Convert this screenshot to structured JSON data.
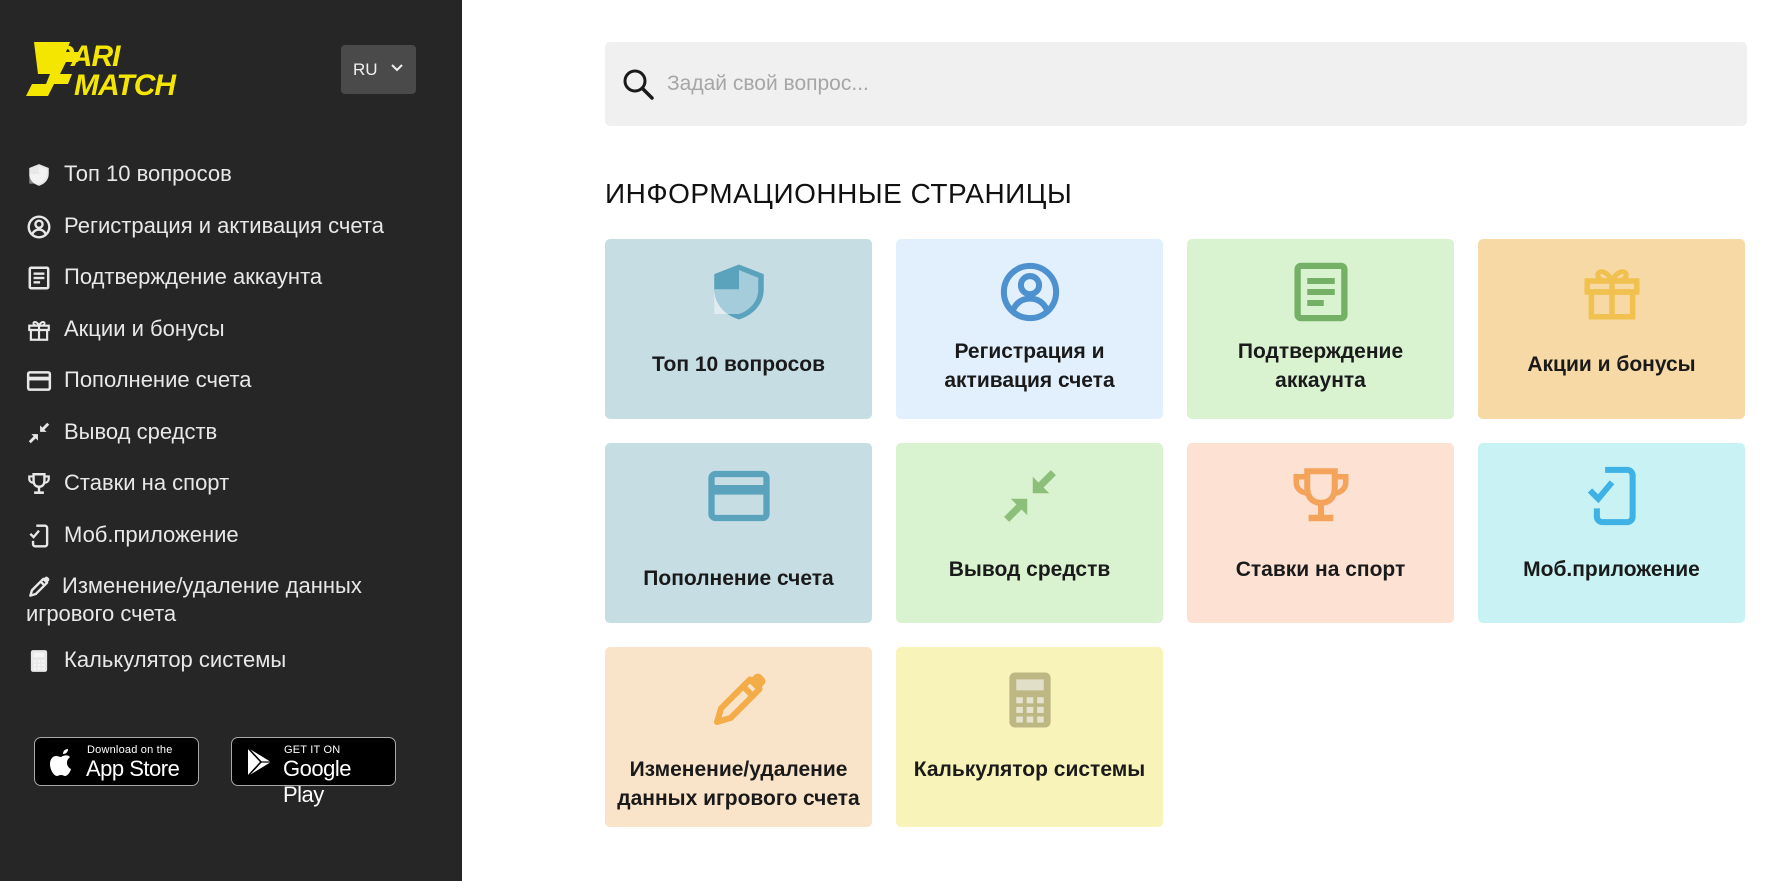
{
  "sidebar": {
    "logo": {
      "line1": "PARI",
      "line2": "MATCH",
      "color": "#f5e600"
    },
    "language": "RU",
    "items": [
      {
        "label": "Топ 10 вопросов",
        "icon": "shield-icon"
      },
      {
        "label": "Регистрация и активация счета",
        "icon": "user-circle-icon"
      },
      {
        "label": "Подтверждение аккаунта",
        "icon": "document-icon"
      },
      {
        "label": "Акции и бонусы",
        "icon": "gift-icon"
      },
      {
        "label": "Пополнение счета",
        "icon": "credit-card-icon"
      },
      {
        "label": "Вывод средств",
        "icon": "arrows-inward-icon"
      },
      {
        "label": "Ставки на спорт",
        "icon": "trophy-icon"
      },
      {
        "label": "Моб.приложение",
        "icon": "mobile-check-icon"
      },
      {
        "label": "Изменение/удаление данных игрового счета",
        "icon": "pencil-icon"
      },
      {
        "label": "Калькулятор системы",
        "icon": "calculator-icon"
      }
    ],
    "stores": {
      "appstore": {
        "small": "Download on the",
        "big": "App Store"
      },
      "googleplay": {
        "small": "GET IT ON",
        "big": "Google Play"
      }
    }
  },
  "search": {
    "placeholder": "Задай свой вопрос..."
  },
  "section": {
    "title": "ИНФОРМАЦИОННЫЕ СТРАНИЦЫ"
  },
  "cards": [
    {
      "label": "Топ 10 вопросов",
      "icon": "shield-icon",
      "bg": "#c6dde4",
      "fg": "#5ba2bc"
    },
    {
      "label": "Регистрация и активация счета",
      "icon": "user-circle-icon",
      "bg": "#e2f0fd",
      "fg": "#4d91ce"
    },
    {
      "label": "Подтверждение аккаунта",
      "icon": "document-icon",
      "bg": "#d9f2d0",
      "fg": "#74b066"
    },
    {
      "label": "Акции и бонусы",
      "icon": "gift-icon",
      "bg": "#f6d9a4",
      "fg": "#f0c14f"
    },
    {
      "label": "Пополнение счета",
      "icon": "credit-card-icon",
      "bg": "#c6dde4",
      "fg": "#5ba2bc"
    },
    {
      "label": "Вывод средств",
      "icon": "arrows-inward-icon",
      "bg": "#d9f2d0",
      "fg": "#8cbf79"
    },
    {
      "label": "Ставки на спорт",
      "icon": "trophy-icon",
      "bg": "#fde1d3",
      "fg": "#f4a35a"
    },
    {
      "label": "Моб.приложение",
      "icon": "mobile-check-icon",
      "bg": "#c8f2f3",
      "fg": "#3eb1e5"
    },
    {
      "label": "Изменение/удаление данных игрового счета",
      "icon": "pencil-icon",
      "bg": "#f9e4c9",
      "fg": "#f3ac48"
    },
    {
      "label": "Калькулятор системы",
      "icon": "calculator-icon",
      "bg": "#f8f3b9",
      "fg": "#bdb883"
    }
  ]
}
